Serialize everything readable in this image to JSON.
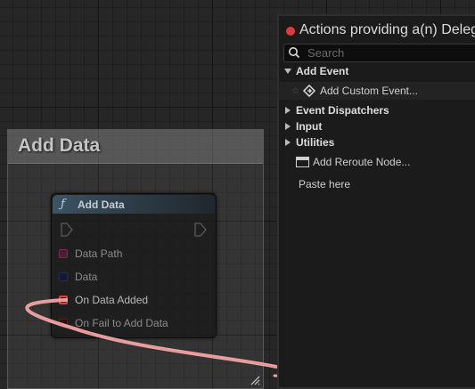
{
  "comment": {
    "title": "Add Data"
  },
  "node": {
    "title": "Add Data",
    "function_icon": "ƒ",
    "pins": [
      {
        "label": "Data Path",
        "color": "#7a2a4c"
      },
      {
        "label": "Data",
        "color": "#1d2b5a"
      },
      {
        "label": "On Data Added",
        "color": "#e0413b"
      },
      {
        "label": "On Fail to Add Data",
        "color": "#5a1c1c"
      }
    ]
  },
  "popup": {
    "title": "Actions providing a(n) Delegate",
    "search": {
      "placeholder": "Search",
      "value": ""
    },
    "categories": {
      "add_event": "Add Event",
      "add_custom_event": "Add Custom Event...",
      "event_dispatchers": "Event Dispatchers",
      "input": "Input",
      "utilities": "Utilities",
      "add_reroute_node": "Add Reroute Node...",
      "paste_here": "Paste here"
    }
  },
  "colors": {
    "wire": "#f3a3a3",
    "close_dot": "#e23a3a",
    "node_header": "#3b5366"
  },
  "icons": {
    "search": "search-icon",
    "function": "function-icon",
    "custom_event": "diamond-event-icon",
    "reroute": "reroute-node-icon",
    "favorite": "star-icon",
    "exec_in": "exec-pin-icon",
    "exec_out": "exec-pin-icon"
  }
}
